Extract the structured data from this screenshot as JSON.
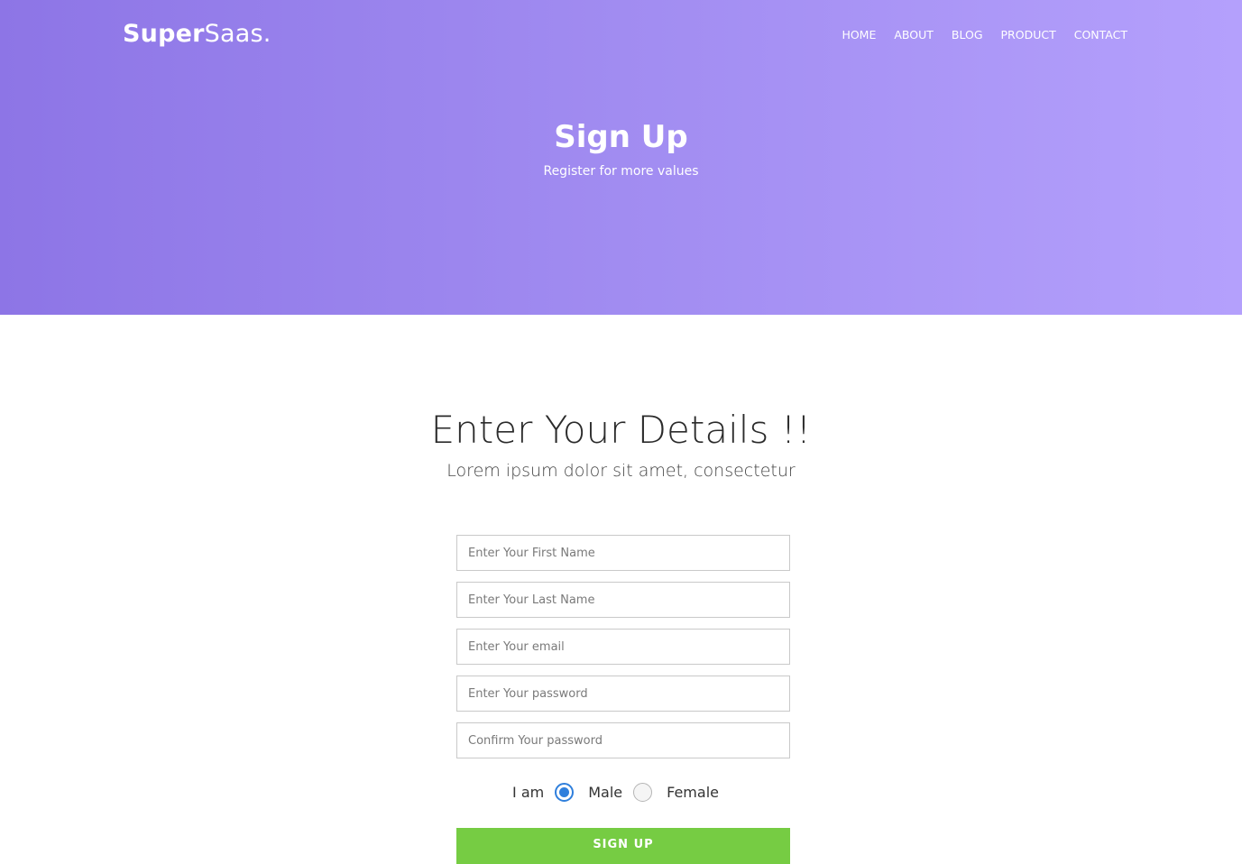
{
  "header": {
    "logo_bold": "Super",
    "logo_light": "Saas.",
    "nav": [
      "HOME",
      "ABOUT",
      "BLOG",
      "PRODUCT",
      "CONTACT"
    ]
  },
  "hero": {
    "title": "Sign Up",
    "subtitle": "Register for more values"
  },
  "form": {
    "title": "Enter Your Details !!",
    "subtitle": "Lorem ipsum dolor sit amet, consectetur",
    "first_name_placeholder": "Enter Your First Name",
    "last_name_placeholder": "Enter Your Last Name",
    "email_placeholder": "Enter Your email",
    "password_placeholder": "Enter Your password",
    "confirm_password_placeholder": "Confirm Your password",
    "gender_label": "I am",
    "gender_options": [
      "Male",
      "Female"
    ],
    "gender_selected": "Male",
    "submit_label": "SIGN UP"
  },
  "colors": {
    "hero_gradient_start": "#8d75e6",
    "hero_gradient_end": "#b4a0fc",
    "button": "#76cc43",
    "radio_selected": "#2f7fdc"
  }
}
